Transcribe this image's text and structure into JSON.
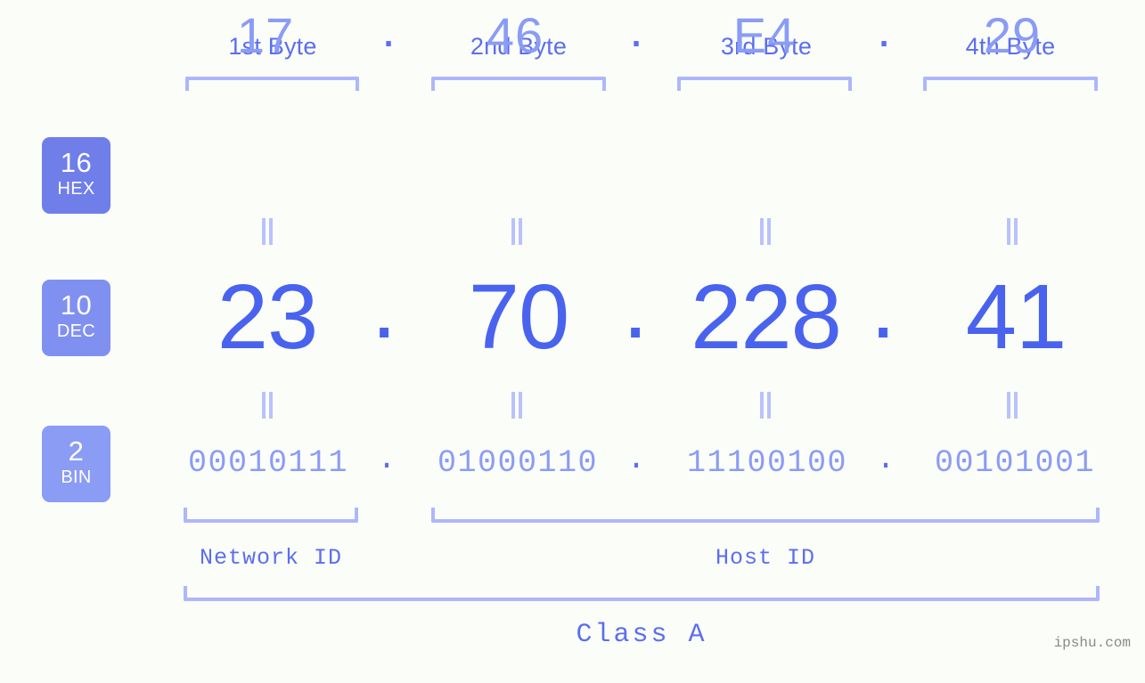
{
  "meta": {
    "watermark": "ipshu.com",
    "background_color": "#fbfdf8",
    "accent_strong": "#4a63ee",
    "accent_mid": "#5b6ef0",
    "accent_light": "#8b9cf5",
    "accent_pale": "#aeb7fb"
  },
  "byte_headers": [
    {
      "label": "1st Byte"
    },
    {
      "label": "2nd Byte"
    },
    {
      "label": "3rd Byte"
    },
    {
      "label": "4th Byte"
    }
  ],
  "rows": {
    "hex": {
      "badge_num": "16",
      "badge_sub": "HEX",
      "badge_color": "#6f7ee9",
      "values": [
        "17",
        "46",
        "E4",
        "29"
      ],
      "separator": "."
    },
    "dec": {
      "badge_num": "10",
      "badge_sub": "DEC",
      "badge_color": "#8090f1",
      "values": [
        "23",
        "70",
        "228",
        "41"
      ],
      "separator": "."
    },
    "bin": {
      "badge_num": "2",
      "badge_sub": "BIN",
      "badge_color": "#8b9cf5",
      "values": [
        "00010111",
        "01000110",
        "11100100",
        "00101001"
      ],
      "separator": "."
    }
  },
  "equals_marker": "=",
  "footer": {
    "network_id_label": "Network ID",
    "host_id_label": "Host ID",
    "class_label": "Class A"
  }
}
